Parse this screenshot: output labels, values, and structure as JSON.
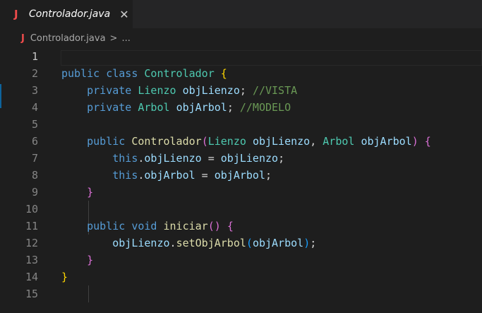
{
  "tab": {
    "icon": "java-icon",
    "icon_glyph": "J",
    "filename": "Controlador.java",
    "close_glyph": "✕"
  },
  "breadcrumb": {
    "icon_glyph": "J",
    "file": "Controlador.java",
    "separator": ">",
    "more": "..."
  },
  "editor": {
    "active_line": 1,
    "lines": [
      {
        "num": "1",
        "tokens": []
      },
      {
        "num": "2",
        "tokens": [
          [
            "kw",
            "public"
          ],
          [
            "pn",
            " "
          ],
          [
            "kw",
            "class"
          ],
          [
            "pn",
            " "
          ],
          [
            "ty",
            "Controlador"
          ],
          [
            "pn",
            " "
          ],
          [
            "b1",
            "{"
          ]
        ]
      },
      {
        "num": "3",
        "tokens": [
          [
            "pn",
            "    "
          ],
          [
            "kw",
            "private"
          ],
          [
            "pn",
            " "
          ],
          [
            "ty",
            "Lienzo"
          ],
          [
            "pn",
            " "
          ],
          [
            "va",
            "objLienzo"
          ],
          [
            "pn",
            "; "
          ],
          [
            "cm",
            "//VISTA"
          ]
        ]
      },
      {
        "num": "4",
        "tokens": [
          [
            "pn",
            "    "
          ],
          [
            "kw",
            "private"
          ],
          [
            "pn",
            " "
          ],
          [
            "ty",
            "Arbol"
          ],
          [
            "pn",
            " "
          ],
          [
            "va",
            "objArbol"
          ],
          [
            "pn",
            "; "
          ],
          [
            "cm",
            "//MODELO"
          ]
        ]
      },
      {
        "num": "5",
        "tokens": []
      },
      {
        "num": "6",
        "tokens": [
          [
            "pn",
            "    "
          ],
          [
            "kw",
            "public"
          ],
          [
            "pn",
            " "
          ],
          [
            "fn",
            "Controlador"
          ],
          [
            "b2",
            "("
          ],
          [
            "ty",
            "Lienzo"
          ],
          [
            "pn",
            " "
          ],
          [
            "va",
            "objLienzo"
          ],
          [
            "pn",
            ", "
          ],
          [
            "ty",
            "Arbol"
          ],
          [
            "pn",
            " "
          ],
          [
            "va",
            "objArbol"
          ],
          [
            "b2",
            ")"
          ],
          [
            "pn",
            " "
          ],
          [
            "b2",
            "{"
          ]
        ]
      },
      {
        "num": "7",
        "tokens": [
          [
            "pn",
            "        "
          ],
          [
            "kw",
            "this"
          ],
          [
            "pn",
            "."
          ],
          [
            "va",
            "objLienzo"
          ],
          [
            "pn",
            " = "
          ],
          [
            "va",
            "objLienzo"
          ],
          [
            "pn",
            ";"
          ]
        ]
      },
      {
        "num": "8",
        "tokens": [
          [
            "pn",
            "        "
          ],
          [
            "kw",
            "this"
          ],
          [
            "pn",
            "."
          ],
          [
            "va",
            "objArbol"
          ],
          [
            "pn",
            " = "
          ],
          [
            "va",
            "objArbol"
          ],
          [
            "pn",
            ";"
          ]
        ]
      },
      {
        "num": "9",
        "tokens": [
          [
            "pn",
            "    "
          ],
          [
            "b2",
            "}"
          ]
        ]
      },
      {
        "num": "10",
        "tokens": []
      },
      {
        "num": "11",
        "tokens": [
          [
            "pn",
            "    "
          ],
          [
            "kw",
            "public"
          ],
          [
            "pn",
            " "
          ],
          [
            "kw",
            "void"
          ],
          [
            "pn",
            " "
          ],
          [
            "fn",
            "iniciar"
          ],
          [
            "b2",
            "()"
          ],
          [
            "pn",
            " "
          ],
          [
            "b2",
            "{"
          ]
        ]
      },
      {
        "num": "12",
        "tokens": [
          [
            "pn",
            "        "
          ],
          [
            "va",
            "objLienzo"
          ],
          [
            "pn",
            "."
          ],
          [
            "fn",
            "setObjArbol"
          ],
          [
            "b3",
            "("
          ],
          [
            "va",
            "objArbol"
          ],
          [
            "b3",
            ")"
          ],
          [
            "pn",
            ";"
          ]
        ]
      },
      {
        "num": "13",
        "tokens": [
          [
            "pn",
            "    "
          ],
          [
            "b2",
            "}"
          ]
        ]
      },
      {
        "num": "14",
        "tokens": [
          [
            "b1",
            "}"
          ]
        ]
      },
      {
        "num": "15",
        "tokens": []
      }
    ]
  }
}
